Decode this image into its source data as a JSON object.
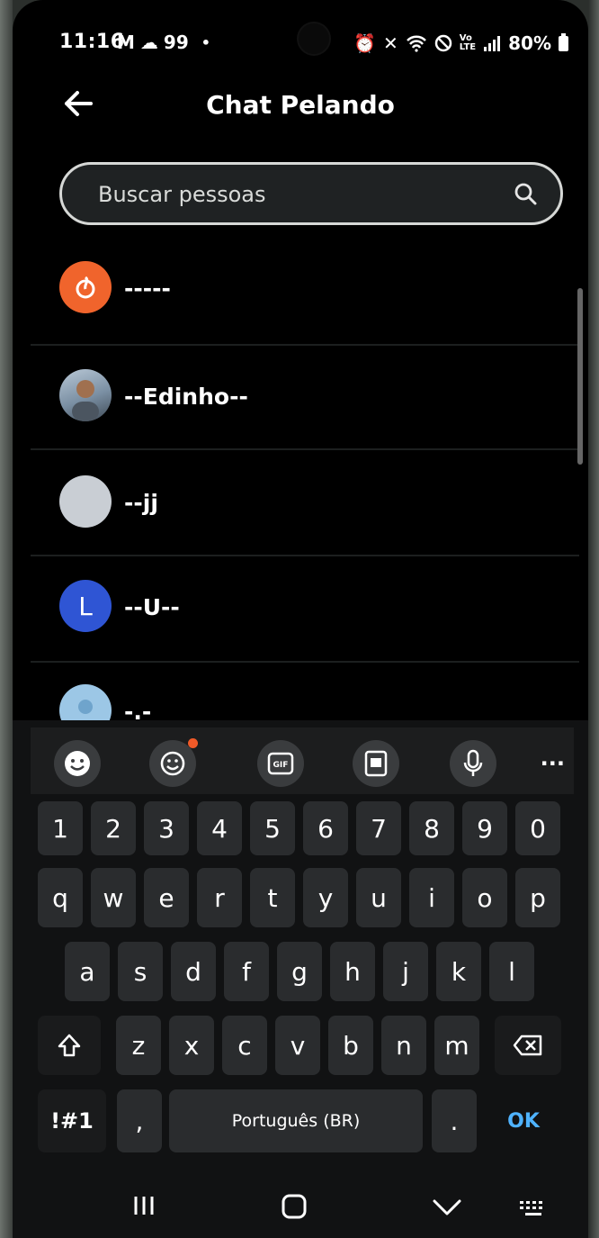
{
  "status_bar": {
    "time": "11:16",
    "left_icons": [
      "gmail-icon",
      "cloud-icon"
    ],
    "notification_count": "99",
    "dot": "•",
    "battery": "80%",
    "right_icons": [
      "alarm-icon",
      "mute-icon",
      "wifi-icon",
      "dnd-icon",
      "volte-icon",
      "signal-icon",
      "battery-icon"
    ]
  },
  "header": {
    "title": "Chat Pelando",
    "back_icon": "arrow-left-icon"
  },
  "search": {
    "placeholder": "Buscar pessoas",
    "icon": "search-icon"
  },
  "contacts": [
    {
      "name": "-----",
      "avatar_type": "logo",
      "avatar_color": "#f0642c"
    },
    {
      "name": "--Edinho--",
      "avatar_type": "photo",
      "avatar_color": "#7a8fa3"
    },
    {
      "name": "--jj",
      "avatar_type": "blank",
      "avatar_color": "#c9ced4"
    },
    {
      "name": "--U--",
      "avatar_type": "letter",
      "avatar_letter": "L",
      "avatar_color": "#2f55d4"
    },
    {
      "name": "-.-",
      "avatar_type": "default",
      "avatar_color": "#9cc7e6"
    }
  ],
  "keyboard": {
    "toolbar": [
      "emoji-icon",
      "sticker-icon",
      "gif-icon",
      "clipboard-icon",
      "mic-icon"
    ],
    "more_label": "...",
    "number_row": [
      "1",
      "2",
      "3",
      "4",
      "5",
      "6",
      "7",
      "8",
      "9",
      "0"
    ],
    "row1": [
      "q",
      "w",
      "e",
      "r",
      "t",
      "y",
      "u",
      "i",
      "o",
      "p"
    ],
    "row2": [
      "a",
      "s",
      "d",
      "f",
      "g",
      "h",
      "j",
      "k",
      "l"
    ],
    "row3": [
      "z",
      "x",
      "c",
      "v",
      "b",
      "n",
      "m"
    ],
    "symbols_label": "!#1",
    "comma_label": ",",
    "space_label": "Português (BR)",
    "period_label": ".",
    "ok_label": "OK",
    "accent_color": "#4fb3ff"
  },
  "nav_bar": [
    "recents-icon",
    "home-icon",
    "back-chevron-icon",
    "keyboard-switch-icon"
  ]
}
